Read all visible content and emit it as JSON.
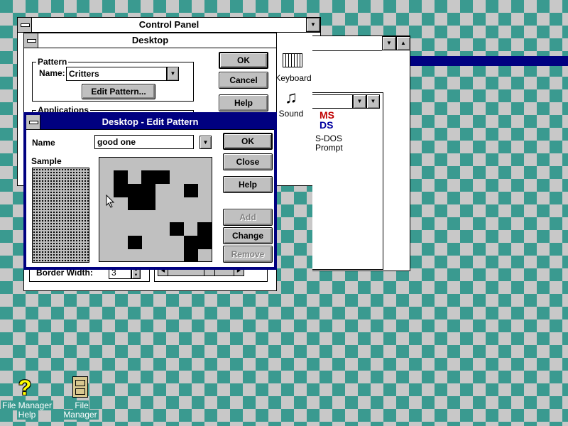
{
  "control_panel": {
    "title": "Control Panel",
    "icons": [
      {
        "label": "Keyboard",
        "icon": "keyboard-icon"
      },
      {
        "label": "Sound",
        "icon": "sound-icon"
      }
    ],
    "msdos_label": "S-DOS",
    "msdos_label2": "Prompt"
  },
  "desktop_dialog": {
    "title": "Desktop",
    "pattern_group": "Pattern",
    "name_label": "Name:",
    "name_value": "Critters",
    "edit_pattern_button": "Edit Pattern...",
    "applications_group": "Applications",
    "border_width_label": "Border Width:",
    "border_width_value": "3",
    "ok_button": "OK",
    "cancel_button": "Cancel",
    "help_button": "Help"
  },
  "edit_pattern_dialog": {
    "title": "Desktop - Edit Pattern",
    "name_label": "Name",
    "name_value": "good one",
    "sample_label": "Sample",
    "ok_button": "OK",
    "close_button": "Close",
    "help_button": "Help",
    "add_button": "Add",
    "change_button": "Change",
    "remove_button": "Remove",
    "pattern_grid": [
      [
        0,
        0,
        0,
        0,
        0,
        0,
        0,
        0
      ],
      [
        0,
        1,
        0,
        1,
        1,
        0,
        0,
        0
      ],
      [
        0,
        1,
        1,
        1,
        0,
        0,
        1,
        0
      ],
      [
        0,
        0,
        1,
        1,
        0,
        0,
        0,
        0
      ],
      [
        0,
        0,
        0,
        0,
        0,
        0,
        0,
        0
      ],
      [
        0,
        0,
        0,
        0,
        0,
        1,
        0,
        1
      ],
      [
        0,
        0,
        1,
        0,
        0,
        0,
        1,
        1
      ],
      [
        0,
        0,
        0,
        0,
        0,
        0,
        1,
        0
      ]
    ]
  },
  "desktop_icons": [
    {
      "label_line1": "File Manager",
      "label_line2": "Help",
      "icon": "help-icon"
    },
    {
      "label_line1": "File Manager",
      "label_line2": "",
      "icon": "file-manager-icon"
    }
  ],
  "colors": {
    "desktop_bg": "#3a9a90",
    "active_title": "#000080",
    "button_face": "#c0c0c0"
  }
}
